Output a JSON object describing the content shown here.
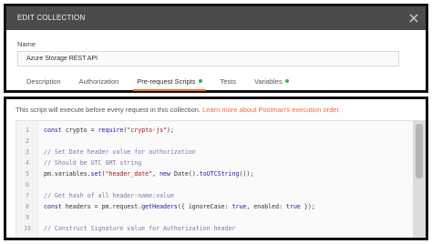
{
  "dialog": {
    "title": "EDIT COLLECTION",
    "name_label": "Name",
    "name_value": "Azure Storage REST API",
    "tabs": [
      {
        "label": "Description",
        "active": false,
        "dot": false
      },
      {
        "label": "Authorization",
        "active": false,
        "dot": false
      },
      {
        "label": "Pre-request Scripts",
        "active": true,
        "dot": true
      },
      {
        "label": "Tests",
        "active": false,
        "dot": false
      },
      {
        "label": "Variables",
        "active": false,
        "dot": true
      }
    ]
  },
  "script_panel": {
    "info_text": "This script will execute before every request in this collection.",
    "info_link": "Learn more about Postman's execution order."
  },
  "code_lines": [
    {
      "n": "1",
      "tokens": [
        {
          "t": "kw",
          "v": "const"
        },
        {
          "t": "p",
          "v": " crypto = "
        },
        {
          "t": "kw",
          "v": "require"
        },
        {
          "t": "p",
          "v": "("
        },
        {
          "t": "str",
          "v": "\"crypto-js\""
        },
        {
          "t": "p",
          "v": ");"
        }
      ]
    },
    {
      "n": "2",
      "tokens": []
    },
    {
      "n": "3",
      "tokens": [
        {
          "t": "cmt",
          "v": "// Set Date header value for authorization"
        }
      ]
    },
    {
      "n": "4",
      "tokens": [
        {
          "t": "cmt",
          "v": "// Should be UTC GMT string"
        }
      ]
    },
    {
      "n": "5",
      "tokens": [
        {
          "t": "p",
          "v": "pm.variables."
        },
        {
          "t": "kw",
          "v": "set"
        },
        {
          "t": "p",
          "v": "("
        },
        {
          "t": "str",
          "v": "\"header_date\""
        },
        {
          "t": "p",
          "v": ", "
        },
        {
          "t": "kw",
          "v": "new"
        },
        {
          "t": "p",
          "v": " Date()."
        },
        {
          "t": "kw",
          "v": "toUTCString"
        },
        {
          "t": "p",
          "v": "());"
        }
      ]
    },
    {
      "n": "6",
      "tokens": []
    },
    {
      "n": "7",
      "tokens": [
        {
          "t": "cmt",
          "v": "// Get hash of all header-name:value"
        }
      ]
    },
    {
      "n": "8",
      "tokens": [
        {
          "t": "kw",
          "v": "const"
        },
        {
          "t": "p",
          "v": " headers = pm.request."
        },
        {
          "t": "kw",
          "v": "getHeaders"
        },
        {
          "t": "p",
          "v": "({ ignoreCase: "
        },
        {
          "t": "kw",
          "v": "true"
        },
        {
          "t": "p",
          "v": ", enabled: "
        },
        {
          "t": "kw",
          "v": "true"
        },
        {
          "t": "p",
          "v": " });"
        }
      ]
    },
    {
      "n": "9",
      "tokens": []
    },
    {
      "n": "10",
      "tokens": [
        {
          "t": "cmt",
          "v": "// Construct Signature value for Authorization header"
        }
      ]
    }
  ],
  "colors": {
    "header_bg": "#4b4b4b",
    "accent_orange": "#f26b3a",
    "status_green": "#3fae49",
    "keyword_blue": "#1a1aa6",
    "string_red": "#a31515",
    "comment": "#7a7aa8"
  },
  "icons": {
    "close": "close-icon"
  }
}
